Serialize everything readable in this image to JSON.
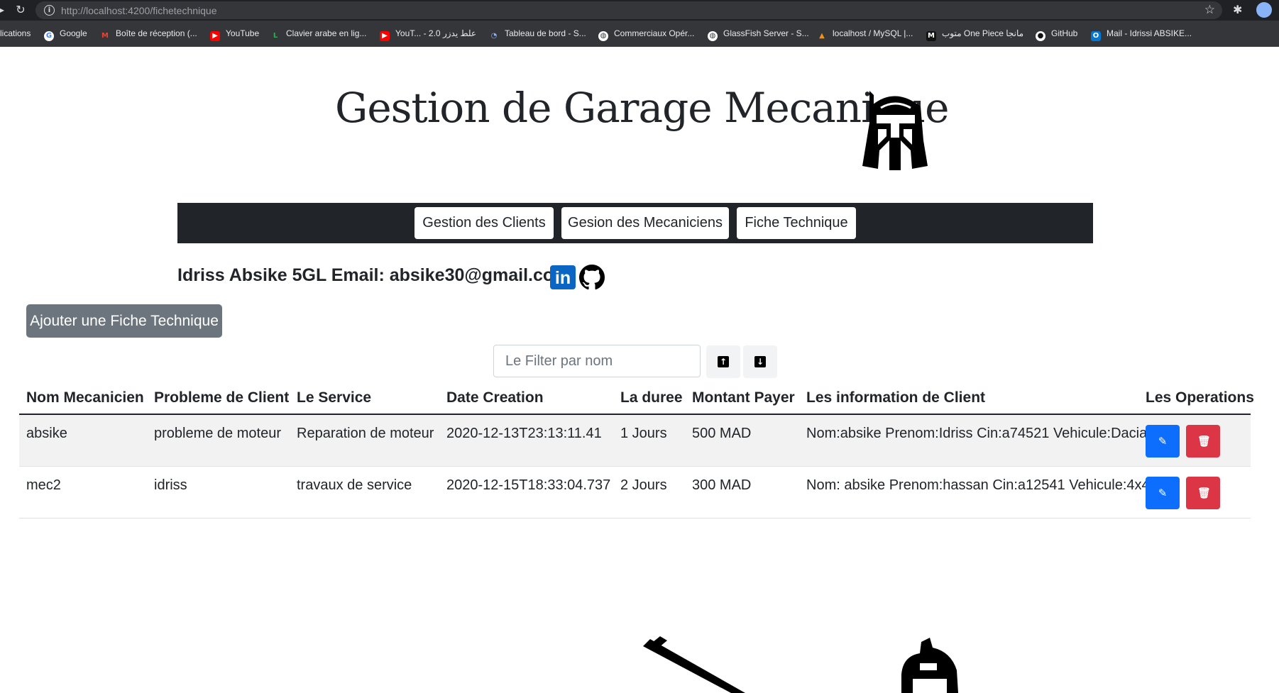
{
  "browser": {
    "url_host": "http://localhost",
    "url_rest": ":4200/fichetechnique",
    "bookmarks": [
      {
        "label": "lications",
        "icon": "apps-icon"
      },
      {
        "label": "Google",
        "icon": "google-icon"
      },
      {
        "label": "Boîte de réception (...",
        "icon": "gmail-icon"
      },
      {
        "label": "YouTube",
        "icon": "youtube-icon"
      },
      {
        "label": "Clavier arabe en lig...",
        "icon": "keyboard-icon"
      },
      {
        "label": "YouT... - 2.0 علط يدزر",
        "icon": "youtube-icon"
      },
      {
        "label": "Tableau de bord - S...",
        "icon": "dashboard-icon"
      },
      {
        "label": "Commerciaux Opér...",
        "icon": "globe-icon"
      },
      {
        "label": "GlassFish Server - S...",
        "icon": "globe-icon"
      },
      {
        "label": "localhost / MySQL |...",
        "icon": "phpmyadmin-icon"
      },
      {
        "label": "متوب One Piece مانجا",
        "icon": "manga-icon"
      },
      {
        "label": "GitHub",
        "icon": "github-icon"
      },
      {
        "label": "Mail - Idrissi ABSIKE...",
        "icon": "outlook-icon"
      }
    ]
  },
  "page": {
    "title": "Gestion de Garage Mecanique",
    "nav": [
      "Gestion des Clients",
      "Gesion des Mecaniciens",
      "Fiche Technique"
    ],
    "author": "Idriss Absike 5GL Email: absike30@gmail.com",
    "add_button": "Ajouter une Fiche Technique",
    "filter_placeholder": "Le Filter par nom"
  },
  "table": {
    "headers": [
      "Nom Mecanicien",
      "Probleme de Client",
      "Le Service",
      "Date Creation",
      "La duree",
      "Montant Payer",
      "Les information de Client",
      "Les Operations"
    ],
    "rows": [
      {
        "mecanicien": "absike",
        "probleme": "probleme de moteur",
        "service": "Reparation de moteur",
        "date": "2020-12-13T23:13:11.41",
        "duree": "1 Jours",
        "montant": "500 MAD",
        "client": "Nom:absike Prenom:Idriss Cin:a74521 Vehicule:Dacia"
      },
      {
        "mecanicien": "mec2",
        "probleme": "idriss",
        "service": "travaux de service",
        "date": "2020-12-15T18:33:04.737",
        "duree": "2 Jours",
        "montant": "300 MAD",
        "client": "Nom: absike Prenom:hassan Cin:a12541 Vehicule:4x4"
      }
    ]
  },
  "colors": {
    "navbar": "#212529",
    "add_button": "#6c757d",
    "edit_button": "#0d6efd",
    "delete_button": "#dc3545",
    "linkedin": "#0a66c2"
  }
}
